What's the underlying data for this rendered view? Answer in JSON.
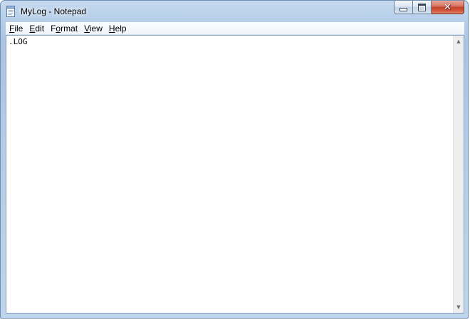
{
  "window": {
    "title": "MyLog - Notepad",
    "icon": "notepad-icon"
  },
  "caption_buttons": {
    "minimize": "minimize-icon",
    "maximize": "maximize-icon",
    "close": "close-icon",
    "close_glyph": "✕"
  },
  "menu": {
    "items": [
      {
        "label_prefix": "",
        "accel": "F",
        "label_rest": "ile"
      },
      {
        "label_prefix": "",
        "accel": "E",
        "label_rest": "dit"
      },
      {
        "label_prefix": "F",
        "accel": "o",
        "label_rest": "rmat"
      },
      {
        "label_prefix": "",
        "accel": "V",
        "label_rest": "iew"
      },
      {
        "label_prefix": "",
        "accel": "H",
        "label_rest": "elp"
      }
    ]
  },
  "editor": {
    "content": ".LOG"
  },
  "scrollbar": {
    "up_glyph": "▲",
    "down_glyph": "▼"
  }
}
